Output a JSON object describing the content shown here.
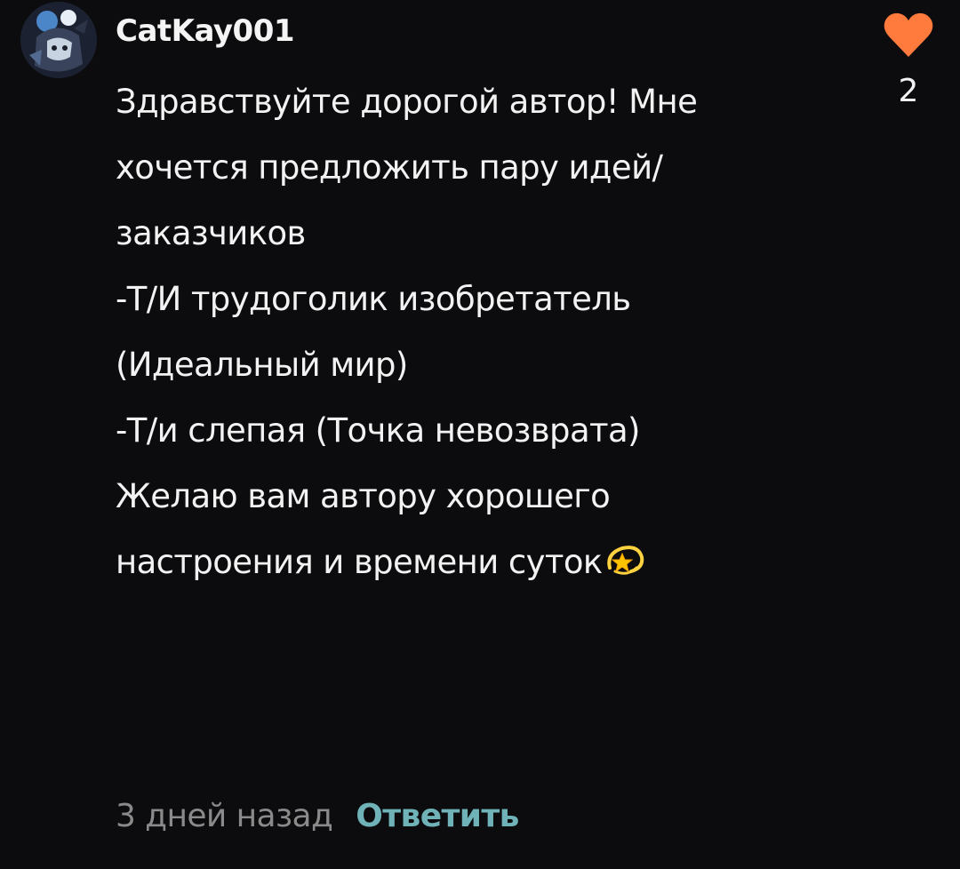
{
  "comment": {
    "username": "CatKay001",
    "paragraphs": [
      "Здравствуйте дорогой автор! Мне\nхочется предложить пару идей/\nзаказчиков",
      "",
      "-Т/И трудоголик изобретатель\n(Идеальный мир)",
      "",
      "-Т/и слепая (Точка невозврата)",
      "",
      "Желаю вам автору хорошего\nнастроения и времени суток"
    ],
    "trailing_emoji": "dizzy-star-icon",
    "timestamp": "3 дней назад",
    "reply_label": "Ответить",
    "like_count": "2",
    "like_icon": "heart-icon"
  },
  "colors": {
    "background": "#0c0b0d",
    "text": "#f2f2f2",
    "timestamp": "#8a8a8a",
    "reply": "#6fb3b8",
    "heart": "#ff7a3d"
  }
}
